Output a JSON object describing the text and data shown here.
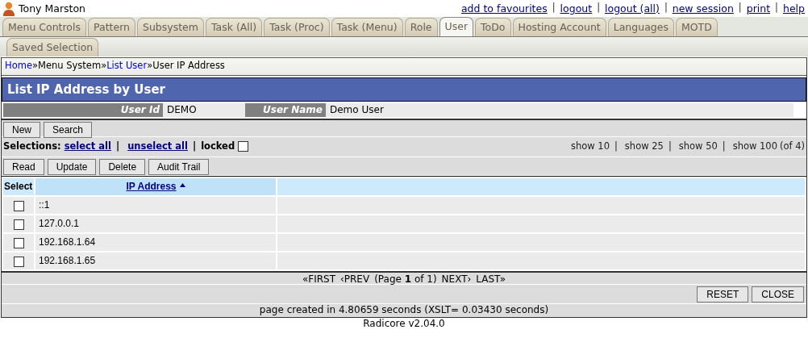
{
  "user": {
    "name": "Tony Marston"
  },
  "top_links": [
    {
      "kind": "link",
      "text": "add to favourites"
    },
    {
      "kind": "sep",
      "text": "|"
    },
    {
      "kind": "link",
      "text": "logout"
    },
    {
      "kind": "sep",
      "text": "|"
    },
    {
      "kind": "link",
      "text": "logout (all)"
    },
    {
      "kind": "sep",
      "text": "|"
    },
    {
      "kind": "link",
      "text": "new session"
    },
    {
      "kind": "sep",
      "text": "|"
    },
    {
      "kind": "link",
      "text": "print"
    },
    {
      "kind": "sep",
      "text": "|"
    },
    {
      "kind": "link",
      "text": "help"
    }
  ],
  "tabs": [
    {
      "label": "Menu Controls",
      "selected": false
    },
    {
      "label": "Pattern",
      "selected": false
    },
    {
      "label": "Subsystem",
      "selected": false
    },
    {
      "label": "Task (All)",
      "selected": false
    },
    {
      "label": "Task (Proc)",
      "selected": false
    },
    {
      "label": "Task (Menu)",
      "selected": false
    },
    {
      "label": "Role",
      "selected": false
    },
    {
      "label": "User",
      "selected": true
    },
    {
      "label": "ToDo",
      "selected": false
    },
    {
      "label": "Hosting Account",
      "selected": false
    },
    {
      "label": "Languages",
      "selected": false
    },
    {
      "label": "MOTD",
      "selected": false
    },
    {
      "label": "Saved Selection",
      "selected": false
    }
  ],
  "breadcrumb": [
    {
      "kind": "link",
      "text": "Home"
    },
    {
      "kind": "sep",
      "text": "»"
    },
    {
      "kind": "text",
      "text": "Menu System"
    },
    {
      "kind": "sep",
      "text": "»"
    },
    {
      "kind": "link",
      "text": "List User"
    },
    {
      "kind": "sep",
      "text": "»"
    },
    {
      "kind": "text",
      "text": "User IP Address"
    }
  ],
  "title": "List IP Address by User",
  "header_fields": [
    {
      "label": "User Id",
      "value": "DEMO"
    },
    {
      "label": "User Name",
      "value": "Demo User"
    }
  ],
  "action_buttons": [
    "New",
    "Search"
  ],
  "selections": [
    {
      "kind": "label",
      "text": "Selections:"
    },
    {
      "kind": "link",
      "text": "select all"
    },
    {
      "kind": "sep",
      "text": "|"
    },
    {
      "kind": "link",
      "text": "unselect all"
    },
    {
      "kind": "sep",
      "text": "|"
    },
    {
      "kind": "label",
      "text": "locked"
    }
  ],
  "locked": {
    "checked": false
  },
  "page_sizes": [
    {
      "kind": "text",
      "text": "show 10"
    },
    {
      "kind": "sep",
      "text": "|"
    },
    {
      "kind": "text",
      "text": "show 25"
    },
    {
      "kind": "sep",
      "text": "|"
    },
    {
      "kind": "text",
      "text": "show 50"
    },
    {
      "kind": "sep",
      "text": "|"
    },
    {
      "kind": "text",
      "text": "show 100"
    },
    {
      "kind": "text",
      "text": "(of 4)"
    }
  ],
  "row_buttons": [
    "Read",
    "Update",
    "Delete",
    "Audit Trail"
  ],
  "table": {
    "columns": [
      {
        "label": "Select",
        "sorted": false
      },
      {
        "label": "IP Address",
        "sorted": true
      }
    ],
    "rows": [
      {
        "ip": "::1",
        "checked": false
      },
      {
        "ip": "127.0.0.1",
        "checked": false
      },
      {
        "ip": "192.168.1.64",
        "checked": false
      },
      {
        "ip": "192.168.1.65",
        "checked": false
      }
    ]
  },
  "pagination": [
    {
      "kind": "text",
      "text": "«FIRST"
    },
    {
      "kind": "text",
      "text": "‹PREV"
    },
    {
      "kind": "info",
      "text": "(Page **1** of 1)"
    },
    {
      "kind": "text",
      "text": "NEXT›"
    },
    {
      "kind": "text",
      "text": "LAST»"
    }
  ],
  "footer_buttons": [
    "RESET",
    "CLOSE"
  ],
  "timing": "page created in 4.80659 seconds (XSLT= 0.03430 seconds)",
  "version": "Radicore v2.04.0"
}
